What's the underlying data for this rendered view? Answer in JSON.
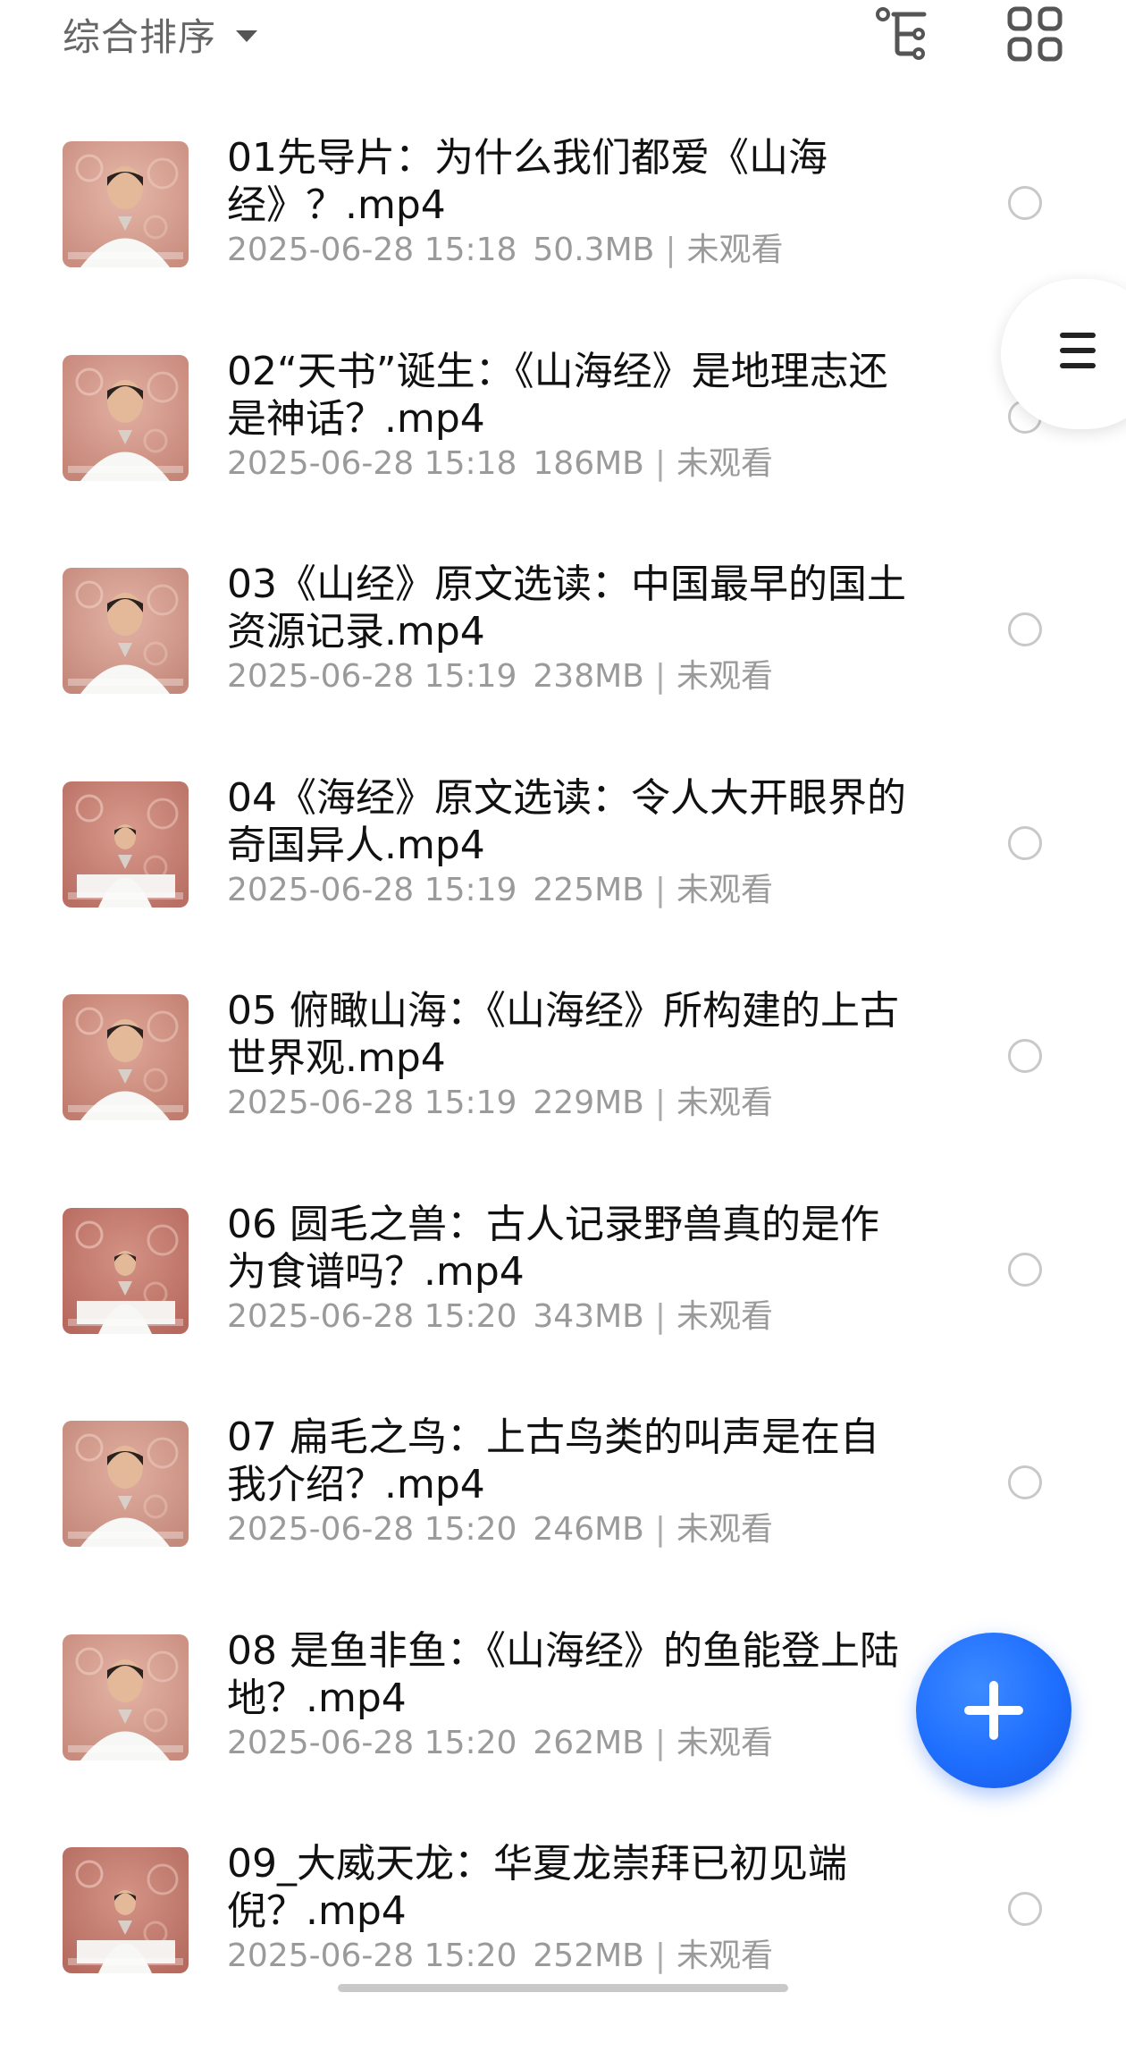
{
  "header": {
    "sort_label": "综合排序",
    "sort_caret_icon": "caret-down-icon",
    "filter_icon": "tree-filter-icon",
    "view_toggle_icon": "grid-view-icon"
  },
  "side_tab": {
    "icon": "menu-lines-icon"
  },
  "fab": {
    "icon": "plus-icon",
    "color": "#1f6fff"
  },
  "files": [
    {
      "title": "01先导片：为什么我们都爱《山海经》？.mp4",
      "date": "2025-06-28 15:18",
      "size": "50.3MB",
      "sep": "|",
      "status": "未观看"
    },
    {
      "title": "02“天书”诞生：《山海经》是地理志还是神话？.mp4",
      "date": "2025-06-28 15:18",
      "size": "186MB",
      "sep": "|",
      "status": "未观看"
    },
    {
      "title": "03《山经》原文选读：中国最早的国土资源记录.mp4",
      "date": "2025-06-28 15:19",
      "size": "238MB",
      "sep": "|",
      "status": "未观看"
    },
    {
      "title": "04《海经》原文选读：令人大开眼界的奇国异人.mp4",
      "date": "2025-06-28 15:19",
      "size": "225MB",
      "sep": "|",
      "status": "未观看"
    },
    {
      "title": "05 俯瞰山海：《山海经》所构建的上古世界观.mp4",
      "date": "2025-06-28 15:19",
      "size": "229MB",
      "sep": "|",
      "status": "未观看"
    },
    {
      "title": "06 圆毛之兽：古人记录野兽真的是作为食谱吗？.mp4",
      "date": "2025-06-28 15:20",
      "size": "343MB",
      "sep": "|",
      "status": "未观看"
    },
    {
      "title": "07 扁毛之鸟：上古鸟类的叫声是在自我介绍？.mp4",
      "date": "2025-06-28 15:20",
      "size": "246MB",
      "sep": "|",
      "status": "未观看"
    },
    {
      "title": "08 是鱼非鱼：《山海经》的鱼能登上陆地？.mp4",
      "date": "2025-06-28 15:20",
      "size": "262MB",
      "sep": "|",
      "status": "未观看"
    },
    {
      "title": "09_大威天龙：华夏龙崇拜已初见端倪？.mp4",
      "date": "2025-06-28 15:20",
      "size": "252MB",
      "sep": "|",
      "status": "未观看"
    }
  ]
}
